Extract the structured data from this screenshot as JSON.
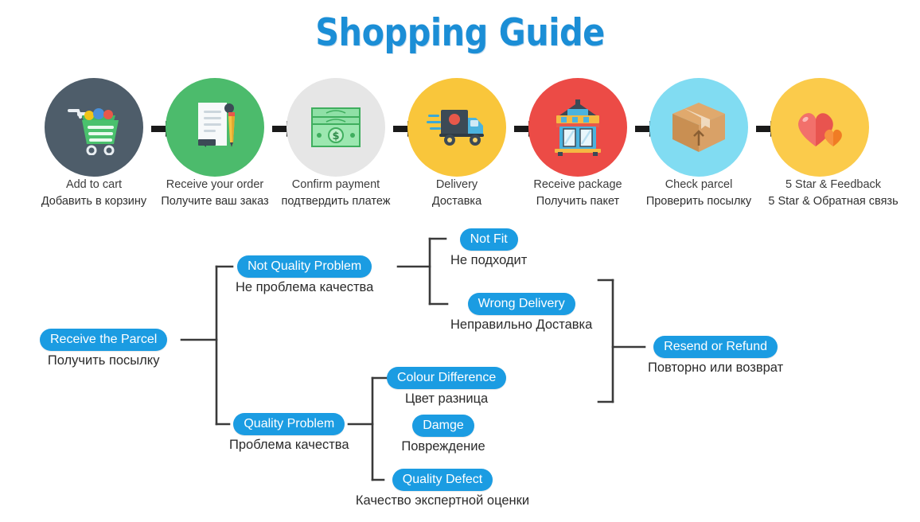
{
  "title": "Shopping Guide",
  "steps": [
    {
      "icon": "shopping-cart-icon",
      "circle_color": "#4e5d6a",
      "en": "Add to cart",
      "ru": "Добавить в корзину"
    },
    {
      "icon": "order-document-icon",
      "circle_color": "#4cbb6c",
      "en": "Receive your order",
      "ru": "Получите ваш заказ"
    },
    {
      "icon": "cash-money-icon",
      "circle_color": "#e6e6e6",
      "en": "Confirm payment",
      "ru": "подтвердить платеж"
    },
    {
      "icon": "delivery-truck-icon",
      "circle_color": "#f9c63b",
      "en": "Delivery",
      "ru": "Доставка"
    },
    {
      "icon": "storefront-icon",
      "circle_color": "#ec4b46",
      "en": "Receive package",
      "ru": "Получить пакет"
    },
    {
      "icon": "parcel-box-icon",
      "circle_color": "#81dcf2",
      "en": "Check parcel",
      "ru": "Проверить посылку"
    },
    {
      "icon": "hearts-feedback-icon",
      "circle_color": "#fbcb4b",
      "en": "5 Star & Feedback",
      "ru": "5 Star & Обратная связь"
    }
  ],
  "arrow_count": 6,
  "flow": {
    "root": {
      "en": "Receive the Parcel",
      "ru": "Получить посылку"
    },
    "not_quality": {
      "en": "Not Quality Problem",
      "ru": "Не проблема качества"
    },
    "not_fit": {
      "en": "Not Fit",
      "ru": "Не подходит"
    },
    "wrong_delivery": {
      "en": "Wrong Delivery",
      "ru": "Неправильно Доставка"
    },
    "resend_refund": {
      "en": "Resend or Refund",
      "ru": "Повторно или возврат"
    },
    "quality_problem": {
      "en": "Quality Problem",
      "ru": "Проблема качества"
    },
    "colour_diff": {
      "en": "Colour Difference",
      "ru": "Цвет разница"
    },
    "damage": {
      "en": "Damge",
      "ru": "Повреждение"
    },
    "quality_defect": {
      "en": "Quality Defect",
      "ru": "Качество экспертной оценки"
    }
  },
  "colors": {
    "title_blue": "#1b8ed6",
    "pill_blue": "#1b9ce2",
    "connector": "#3a3a3a",
    "caption_text": "#2f2f2f"
  }
}
